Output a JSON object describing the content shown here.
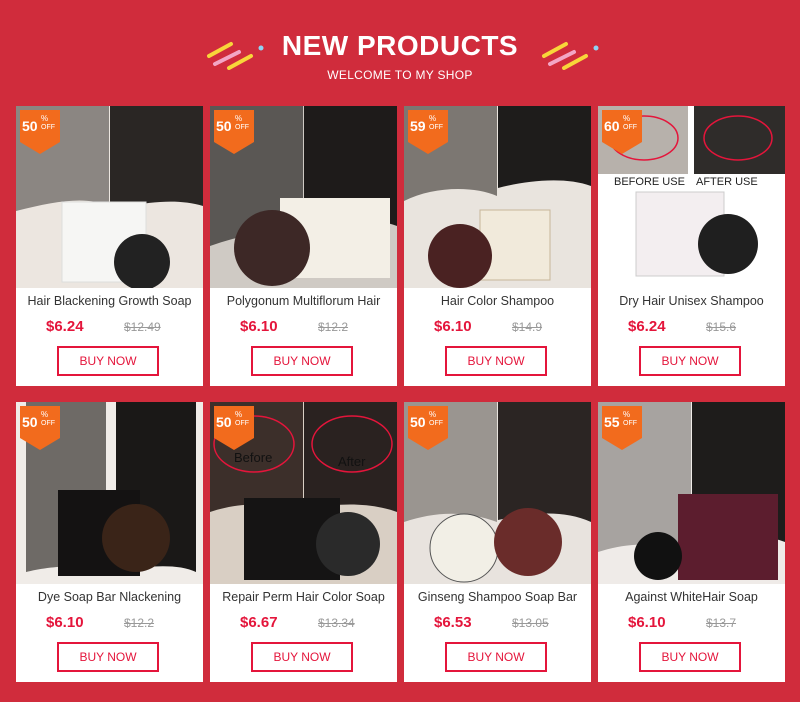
{
  "header": {
    "title": "NEW PRODUCTS",
    "subtitle": "WELCOME TO MY SHOP"
  },
  "products": [
    {
      "name": "Hair Blackening Growth Soap",
      "price": "$6.24",
      "old_price": "$12.49",
      "discount": "50",
      "pct": "%",
      "off": "OFF",
      "button": "BUY NOW"
    },
    {
      "name": "Polygonum Multiflorum Hair",
      "price": "$6.10",
      "old_price": "$12.2",
      "discount": "50",
      "pct": "%",
      "off": "OFF",
      "button": "BUY NOW"
    },
    {
      "name": "Hair Color Shampoo",
      "price": "$6.10",
      "old_price": "$14.9",
      "discount": "59",
      "pct": "%",
      "off": "OFF",
      "button": "BUY NOW"
    },
    {
      "name": "Dry Hair Unisex Shampoo",
      "price": "$6.24",
      "old_price": "$15.6",
      "discount": "60",
      "pct": "%",
      "off": "OFF",
      "button": "BUY NOW",
      "image_labels": [
        "BEFORE USE",
        "AFTER USE"
      ]
    },
    {
      "name": "Dye Soap Bar Nlackening",
      "price": "$6.10",
      "old_price": "$12.2",
      "discount": "50",
      "pct": "%",
      "off": "OFF",
      "button": "BUY NOW"
    },
    {
      "name": "Repair Perm Hair Color Soap",
      "price": "$6.67",
      "old_price": "$13.34",
      "discount": "50",
      "pct": "%",
      "off": "OFF",
      "button": "BUY NOW",
      "image_labels": [
        "Before",
        "After"
      ]
    },
    {
      "name": "Ginseng Shampoo Soap Bar",
      "price": "$6.53",
      "old_price": "$13.05",
      "discount": "50",
      "pct": "%",
      "off": "OFF",
      "button": "BUY NOW"
    },
    {
      "name": "Against WhiteHair Soap",
      "price": "$6.10",
      "old_price": "$13.7",
      "discount": "55",
      "pct": "%",
      "off": "OFF",
      "button": "BUY NOW"
    }
  ],
  "colors": {
    "background": "#d02c3c",
    "accent_red": "#e4153b",
    "badge_orange": "#f26b1d"
  }
}
